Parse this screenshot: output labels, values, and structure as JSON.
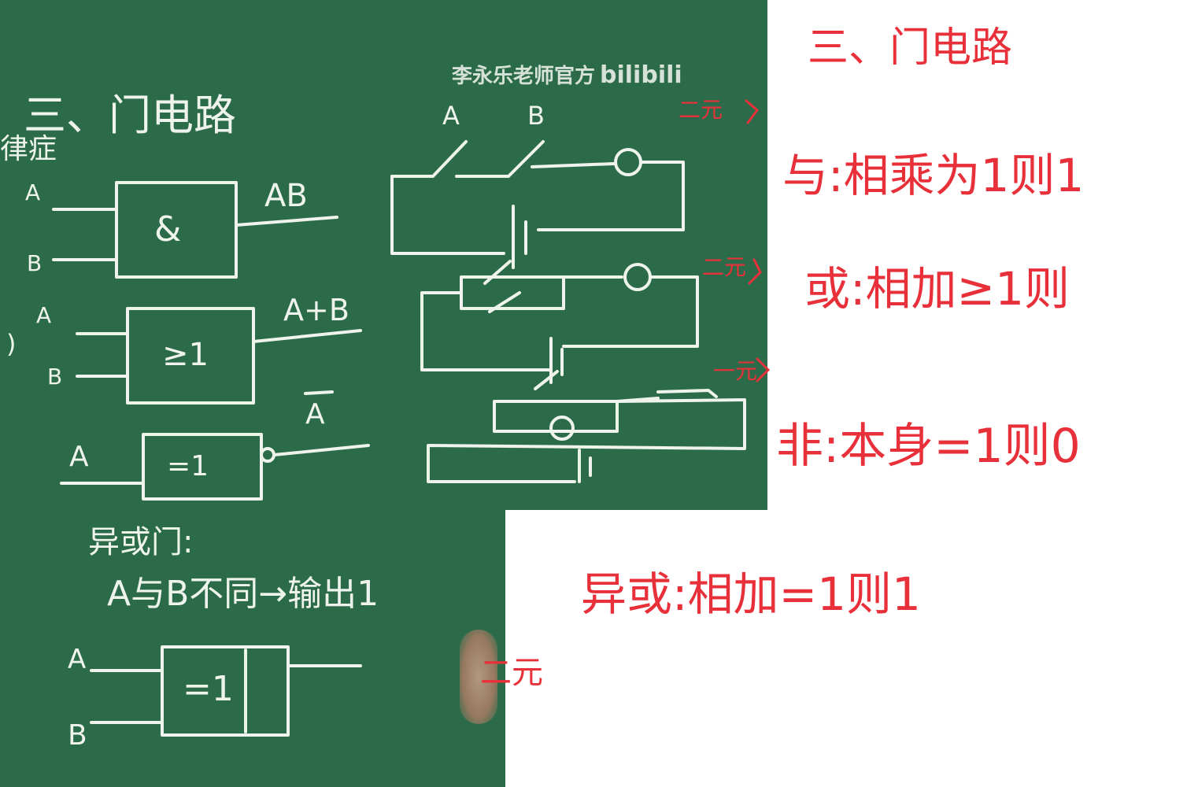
{
  "board_top": {
    "title": "三、门电路",
    "watermark_text": "李永乐老师官方",
    "watermark_brand": "bilibili",
    "left_fragment": "律症",
    "and_gate": {
      "input_a": "A",
      "input_b": "B",
      "symbol": "&",
      "output": "AB"
    },
    "or_gate": {
      "input_a": "A",
      "input_b": "B",
      "symbol": "≥1",
      "output": "A+B",
      "paren": ")"
    },
    "not_gate": {
      "input": "A",
      "symbol": "=1",
      "output": "A"
    },
    "switch_labels": {
      "a": "A",
      "b": "B"
    }
  },
  "board_bottom": {
    "xor_heading": "异或门:",
    "xor_rule": "A与B不同→输出1",
    "xor_gate": {
      "input_a": "A",
      "input_b": "B",
      "symbol": "=1"
    }
  },
  "notes": {
    "title": "三、门电路",
    "and_rule": "与:相乘为1则1",
    "or_rule": "或:相加≥1则",
    "not_rule": "非:本身=1则0",
    "xor_rule": "异或:相加=1则1",
    "binary_tag": "二元",
    "unary_tag": "一元"
  },
  "colors": {
    "board": "#2c6b4a",
    "chalk": "#eef3ec",
    "ink": "#e8303a"
  }
}
